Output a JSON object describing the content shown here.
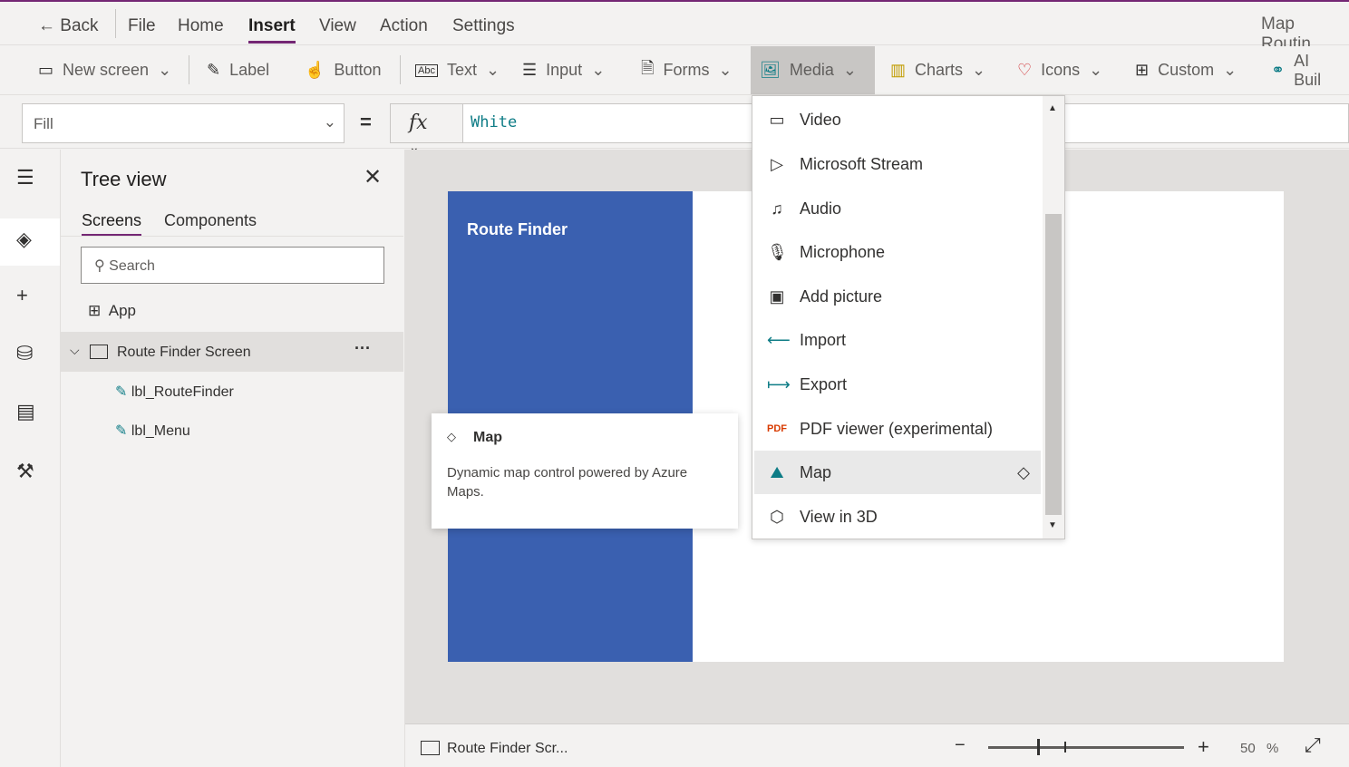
{
  "menu": {
    "back": "Back",
    "items": [
      "File",
      "Home",
      "Insert",
      "View",
      "Action",
      "Settings"
    ],
    "active": "Insert",
    "app_title": "Map Routin"
  },
  "ribbon": {
    "new_screen": "New screen",
    "label": "Label",
    "button": "Button",
    "text": "Text",
    "input": "Input",
    "forms": "Forms",
    "media": "Media",
    "charts": "Charts",
    "icons": "Icons",
    "custom": "Custom",
    "ai": "AI Buil"
  },
  "formula": {
    "property": "Fill",
    "equals": "=",
    "fx": "fx",
    "value": "White"
  },
  "tree": {
    "title": "Tree view",
    "tabs": [
      "Screens",
      "Components"
    ],
    "active_tab": "Screens",
    "search_placeholder": "Search",
    "items": [
      {
        "label": "App"
      },
      {
        "label": "Route Finder Screen",
        "more": "···"
      },
      {
        "label": "lbl_RouteFinder"
      },
      {
        "label": "lbl_Menu"
      }
    ]
  },
  "canvas": {
    "panel_title": "Route Finder",
    "panel_color": "#3a60b0"
  },
  "media_menu": {
    "items": [
      "Video",
      "Microsoft Stream",
      "Audio",
      "Microphone",
      "Add picture",
      "Import",
      "Export",
      "PDF viewer (experimental)",
      "Map",
      "View in 3D"
    ],
    "highlighted": "Map"
  },
  "tooltip": {
    "title": "Map",
    "description": "Dynamic map control powered by Azure Maps."
  },
  "status": {
    "screen": "Route Finder Scr...",
    "zoom_percent": 50,
    "zoom_unit": "%",
    "zoom_minus": "−",
    "zoom_plus": "+"
  },
  "accent": "#742774"
}
